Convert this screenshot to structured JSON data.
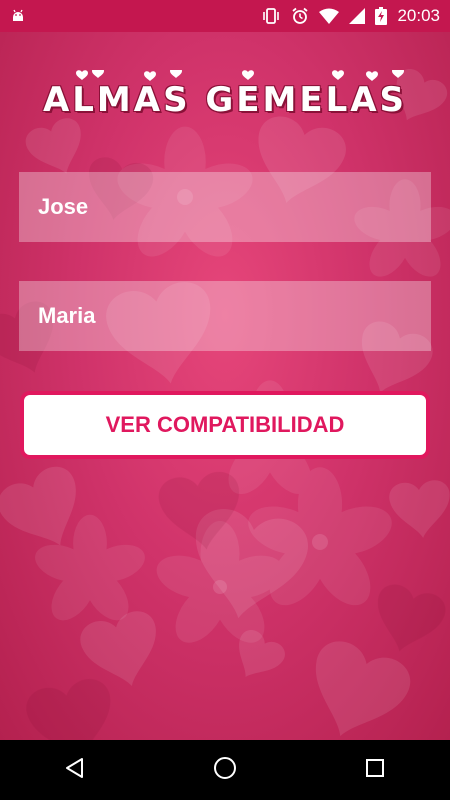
{
  "status_bar": {
    "time": "20:03",
    "icons": [
      "android-debug-icon",
      "vibrate-icon",
      "alarm-icon",
      "wifi-icon",
      "signal-icon",
      "battery-charging-icon"
    ]
  },
  "app": {
    "title": "ALMAS GEMELAS",
    "first_name": {
      "value": "Jose",
      "placeholder": ""
    },
    "second_name": {
      "value": "Maria",
      "placeholder": ""
    },
    "button_label": "VER COMPATIBILIDAD"
  },
  "nav": {
    "buttons": [
      "back-icon",
      "home-icon",
      "recents-icon"
    ]
  },
  "colors": {
    "accent": "#e0185e",
    "status_bar": "#c4174f",
    "background": "#d0336a",
    "nav_bar": "#000000"
  }
}
